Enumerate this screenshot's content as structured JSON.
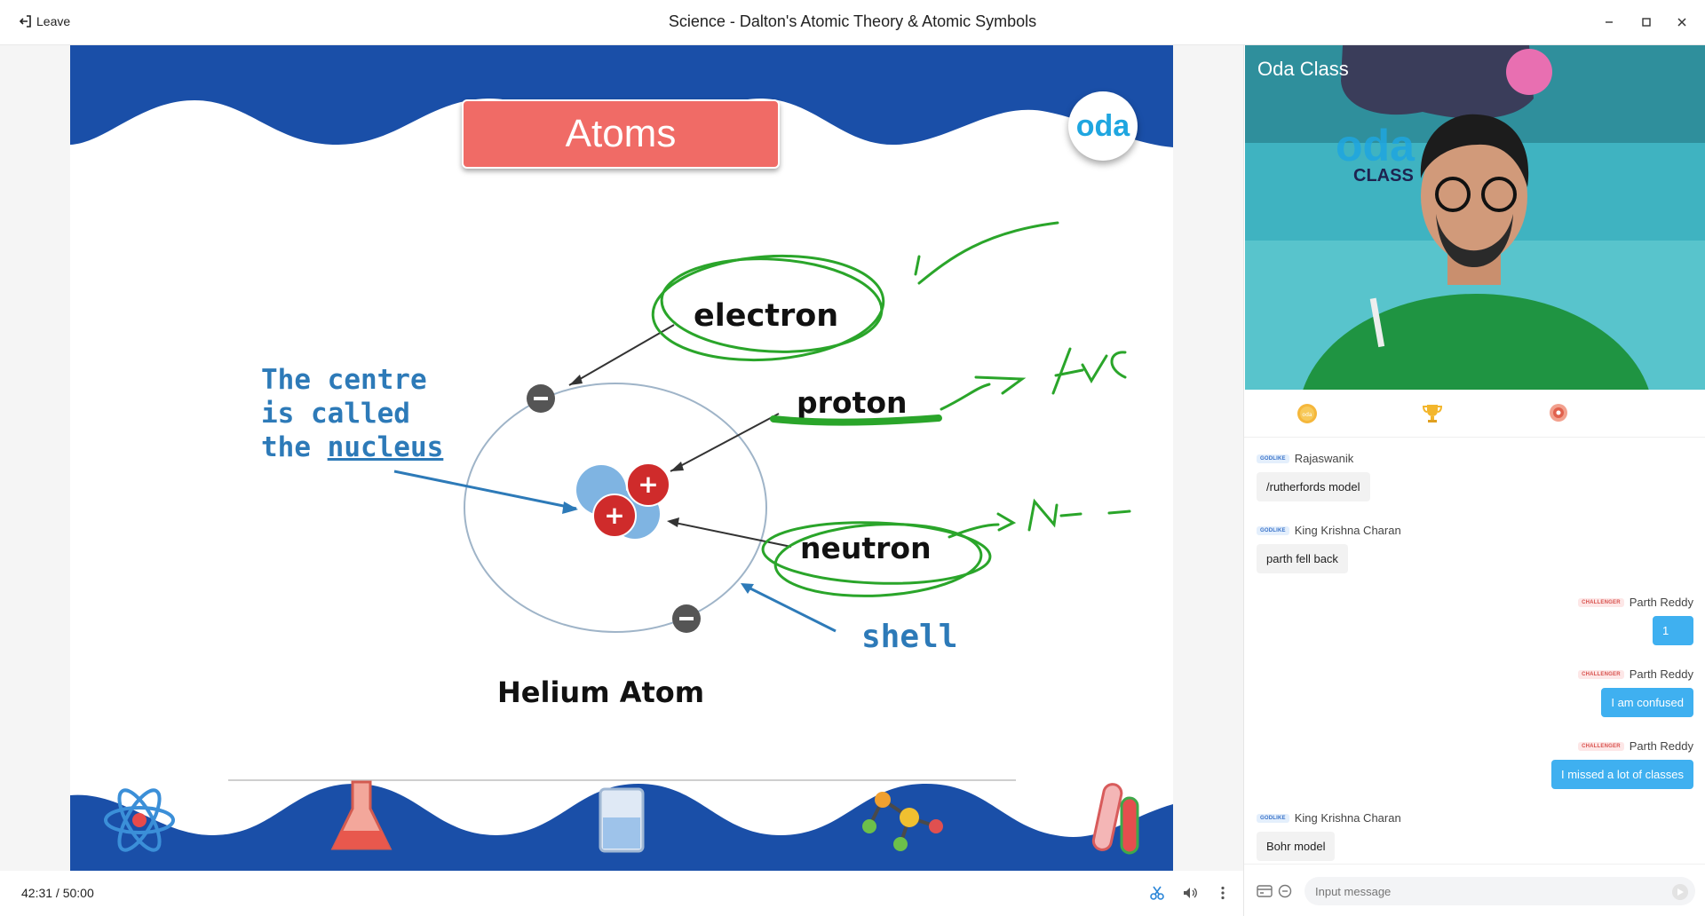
{
  "titlebar": {
    "leave_label": "Leave",
    "title": "Science - Dalton's Atomic Theory & Atomic Symbols",
    "icons": [
      "leave-icon",
      "minimize-icon",
      "maximize-icon",
      "close-icon"
    ]
  },
  "slide": {
    "banner": "Atoms",
    "logo": "oda",
    "centre_lines": [
      "The centre",
      "is called",
      "the "
    ],
    "centre_underlined": "nucleus",
    "labels": {
      "electron": "electron",
      "proton": "proton",
      "neutron": "neutron",
      "shell": "shell",
      "caption": "Helium Atom"
    },
    "annotations": {
      "proton_charge": "+ve",
      "neutron_charge": "N—"
    },
    "colors": {
      "wave_blue": "#1a4fa8",
      "banner_red": "#f06b66",
      "ink_green": "#2aa52a",
      "text_blue": "#2d7ab8"
    }
  },
  "bottombar": {
    "elapsed": "42:31",
    "total": "50:00",
    "time_label": "42:31  / 50:00",
    "icons": [
      "scissors-icon",
      "volume-icon",
      "more-vertical-icon"
    ]
  },
  "video": {
    "sign_text": "Oda Class",
    "wall_logo_top": "oda",
    "wall_logo_bottom": "CLASS"
  },
  "tabs": [
    "oda-coin-icon",
    "trophy-icon",
    "badge-icon"
  ],
  "chat": {
    "messages": [
      {
        "side": "left",
        "badge": "GODLIKE",
        "name": "Rajaswanik",
        "text": "/rutherfords model"
      },
      {
        "side": "left",
        "badge": "GODLIKE",
        "name": "King Krishna Charan",
        "text": "parth fell back"
      },
      {
        "side": "right",
        "badge": "CHALLENGER",
        "name": "Parth Reddy",
        "text": "1"
      },
      {
        "side": "right",
        "badge": "CHALLENGER",
        "name": "Parth Reddy",
        "text": "I am confused"
      },
      {
        "side": "right",
        "badge": "CHALLENGER",
        "name": "Parth Reddy",
        "text": "I missed a lot of classes"
      },
      {
        "side": "left",
        "badge": "GODLIKE",
        "name": "King Krishna Charan",
        "text": "Bohr model"
      }
    ],
    "input_placeholder": "Input message"
  }
}
